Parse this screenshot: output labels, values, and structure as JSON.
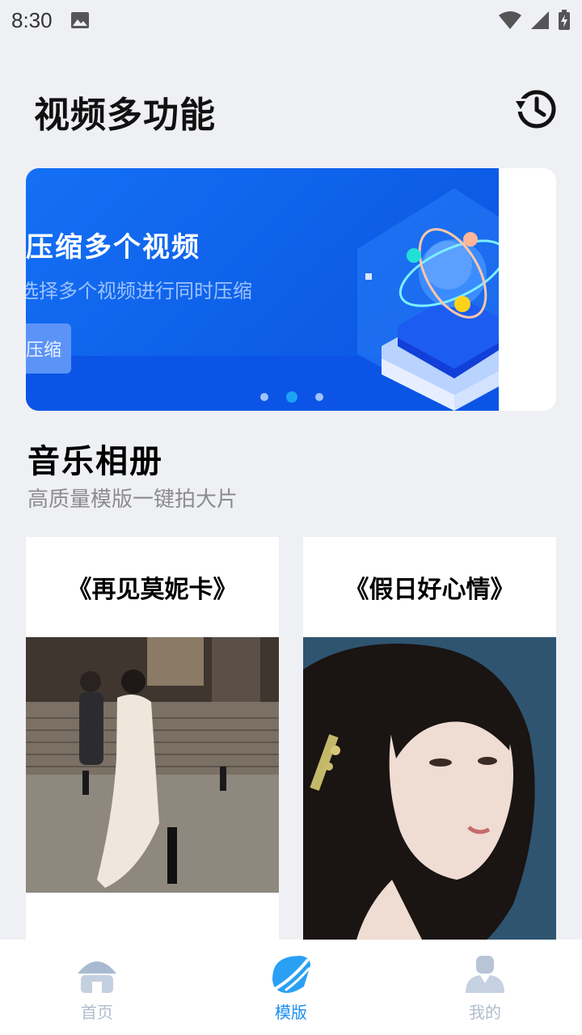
{
  "status_bar": {
    "time": "8:30",
    "icons": [
      "image-icon",
      "wifi-icon",
      "signal-icon",
      "battery-icon"
    ]
  },
  "header": {
    "title": "视频多功能",
    "history_icon": "history-icon"
  },
  "banner": {
    "title": "压缩多个视频",
    "subtitle": "选择多个视频进行同时压缩",
    "button_label": "压缩",
    "dots_count": 3,
    "active_dot": 2,
    "colors": {
      "background": "#1470f5",
      "dot_active": "#1ba2f5"
    }
  },
  "section": {
    "title": "音乐相册",
    "subtitle": "高质量模版一键拍大片"
  },
  "cards": [
    {
      "title": "《再见莫妮卡》",
      "photo": "couple-walking-photo"
    },
    {
      "title": "《假日好心情》",
      "photo": "girl-portrait-photo"
    }
  ],
  "bottom_nav": {
    "items": [
      {
        "label": "首页",
        "icon": "home-icon",
        "active": false
      },
      {
        "label": "模版",
        "icon": "template-icon",
        "active": true
      },
      {
        "label": "我的",
        "icon": "profile-icon",
        "active": false
      }
    ],
    "colors": {
      "active": "#1e8ff2",
      "inactive": "#b0bccd"
    }
  }
}
